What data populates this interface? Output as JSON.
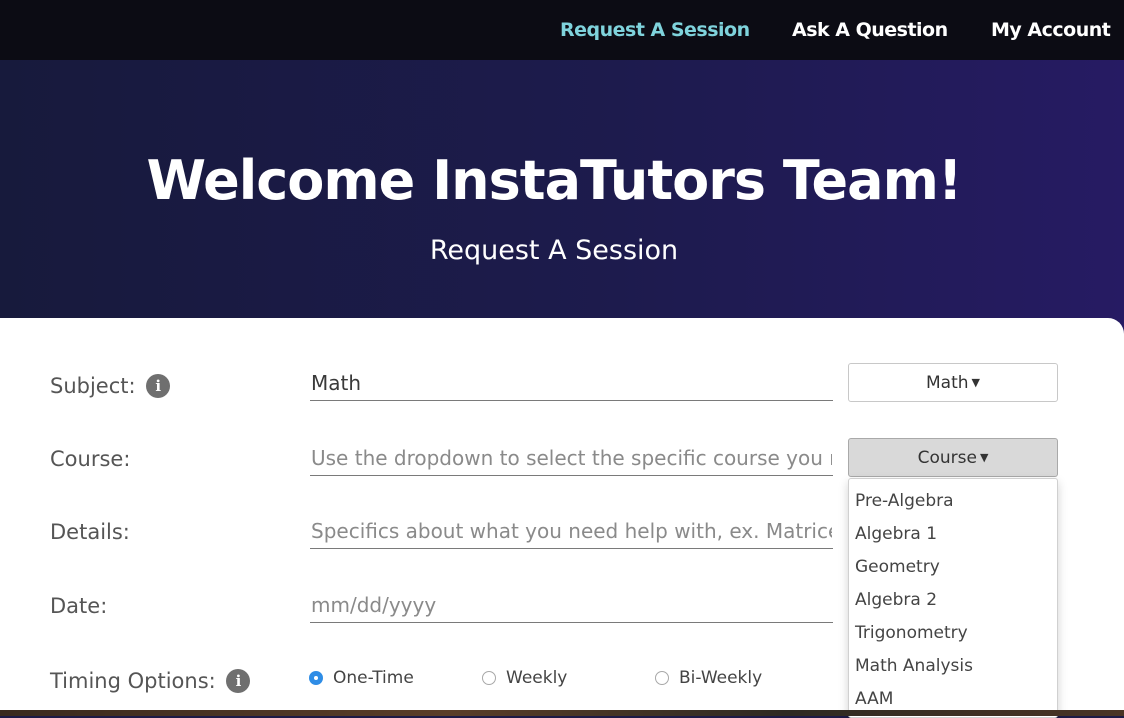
{
  "nav": {
    "links": [
      {
        "label": "Request A Session",
        "active": true
      },
      {
        "label": "Ask A Question",
        "active": false
      },
      {
        "label": "My Account",
        "active": false
      }
    ]
  },
  "hero": {
    "title": "Welcome InstaTutors Team!",
    "subtitle": "Request A Session"
  },
  "form": {
    "subject": {
      "label": "Subject:",
      "value": "Math",
      "dropdown_label": "Math"
    },
    "course": {
      "label": "Course:",
      "placeholder": "Use the dropdown to select the specific course you need help with",
      "dropdown_label": "Course",
      "options": [
        "Pre-Algebra",
        "Algebra 1",
        "Geometry",
        "Algebra 2",
        "Trigonometry",
        "Math Analysis",
        "AAM"
      ]
    },
    "details": {
      "label": "Details:",
      "placeholder": "Specifics about what you need help with, ex. Matrices; Midterm prep"
    },
    "date": {
      "label": "Date:",
      "placeholder": "mm/dd/yyyy"
    },
    "timing": {
      "label": "Timing Options:",
      "options": [
        {
          "label": "One-Time",
          "selected": true
        },
        {
          "label": "Weekly",
          "selected": false
        },
        {
          "label": "Bi-Weekly",
          "selected": false
        }
      ]
    }
  },
  "icons": {
    "info": "info-icon",
    "caret": "caret-down-icon"
  },
  "colors": {
    "accent": "#7fd3dc",
    "radio_selected": "#2f8de6"
  }
}
